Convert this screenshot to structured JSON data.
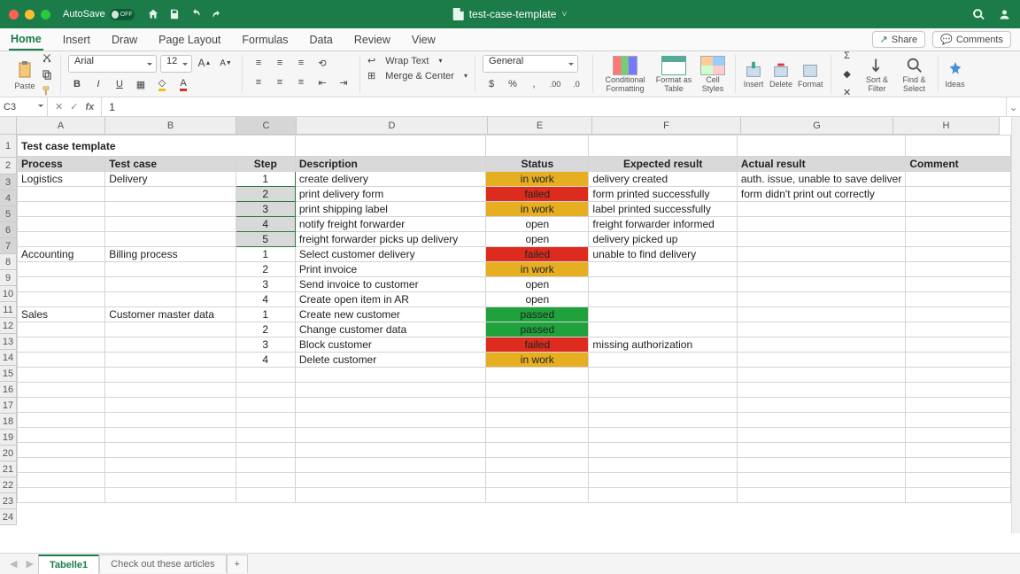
{
  "titlebar": {
    "autosave_label": "AutoSave",
    "autosave_state": "OFF",
    "filename": "test-case-template",
    "chevron": "˅"
  },
  "ribbon_tabs": [
    "Home",
    "Insert",
    "Draw",
    "Page Layout",
    "Formulas",
    "Data",
    "Review",
    "View"
  ],
  "ribbon_right": {
    "share": "Share",
    "comments": "Comments"
  },
  "clipboard": {
    "paste": "Paste"
  },
  "font": {
    "name": "Arial",
    "size": "12"
  },
  "align": {
    "wrap": "Wrap Text",
    "merge": "Merge & Center"
  },
  "number": {
    "format": "General"
  },
  "styles": {
    "cond": "Conditional Formatting",
    "tbl": "Format as Table",
    "cell": "Cell Styles"
  },
  "cells": {
    "ins": "Insert",
    "del": "Delete",
    "fmt": "Format"
  },
  "editing": {
    "sort": "Sort & Filter",
    "find": "Find & Select"
  },
  "ideas": "Ideas",
  "namebox": "C3",
  "formula": "1",
  "columns": [
    "A",
    "B",
    "C",
    "D",
    "E",
    "F",
    "G",
    "H"
  ],
  "sheet_title": "Test case template",
  "headers": {
    "A": "Process",
    "B": "Test case",
    "C": "Step",
    "D": "Description",
    "E": "Status",
    "F": "Expected result",
    "G": "Actual result",
    "H": "Comment"
  },
  "rows": [
    {
      "n": 3,
      "A": "Logistics",
      "B": "Delivery",
      "C": "1",
      "D": "create delivery",
      "E": "in work",
      "F": "delivery created",
      "G": "auth. issue, unable to save deliver",
      "H": "",
      "st": "inwork",
      "sel": "active"
    },
    {
      "n": 4,
      "A": "",
      "B": "",
      "C": "2",
      "D": "print delivery form",
      "E": "failed",
      "F": "form printed successfully",
      "G": "form didn't print out correctly",
      "H": "",
      "st": "failed",
      "sel": "y"
    },
    {
      "n": 5,
      "A": "",
      "B": "",
      "C": "3",
      "D": "print shipping label",
      "E": "in work",
      "F": "label printed successfully",
      "G": "",
      "H": "",
      "st": "inwork",
      "sel": "y"
    },
    {
      "n": 6,
      "A": "",
      "B": "",
      "C": "4",
      "D": "notify freight forwarder",
      "E": "open",
      "F": "freight forwarder informed",
      "G": "",
      "H": "",
      "st": "open",
      "sel": "y"
    },
    {
      "n": 7,
      "A": "",
      "B": "",
      "C": "5",
      "D": "freight forwarder picks up delivery",
      "E": "open",
      "F": "delivery picked up",
      "G": "",
      "H": "",
      "st": "open",
      "sel": "y"
    },
    {
      "n": 8,
      "A": "Accounting",
      "B": "Billing process",
      "C": "1",
      "D": "Select customer delivery",
      "E": "failed",
      "F": "unable to find delivery",
      "G": "",
      "H": "",
      "st": "failed"
    },
    {
      "n": 9,
      "A": "",
      "B": "",
      "C": "2",
      "D": "Print invoice",
      "E": "in work",
      "F": "",
      "G": "",
      "H": "",
      "st": "inwork"
    },
    {
      "n": 10,
      "A": "",
      "B": "",
      "C": "3",
      "D": "Send invoice to customer",
      "E": "open",
      "F": "",
      "G": "",
      "H": "",
      "st": "open"
    },
    {
      "n": 11,
      "A": "",
      "B": "",
      "C": "4",
      "D": "Create open item in AR",
      "E": "open",
      "F": "",
      "G": "",
      "H": "",
      "st": "open"
    },
    {
      "n": 12,
      "A": "Sales",
      "B": "Customer master data",
      "C": "1",
      "D": "Create new customer",
      "E": "passed",
      "F": "",
      "G": "",
      "H": "",
      "st": "passed"
    },
    {
      "n": 13,
      "A": "",
      "B": "",
      "C": "2",
      "D": "Change customer data",
      "E": "passed",
      "F": "",
      "G": "",
      "H": "",
      "st": "passed"
    },
    {
      "n": 14,
      "A": "",
      "B": "",
      "C": "3",
      "D": "Block customer",
      "E": "failed",
      "F": "missing authorization",
      "G": "",
      "H": "",
      "st": "failed"
    },
    {
      "n": 15,
      "A": "",
      "B": "",
      "C": "4",
      "D": "Delete customer",
      "E": "in work",
      "F": "",
      "G": "",
      "H": "",
      "st": "inwork"
    }
  ],
  "empty_rows": [
    16,
    17,
    18,
    19,
    20,
    21,
    22,
    23,
    24
  ],
  "sheet_tabs": {
    "active": "Tabelle1",
    "other": "Check out these articles"
  }
}
